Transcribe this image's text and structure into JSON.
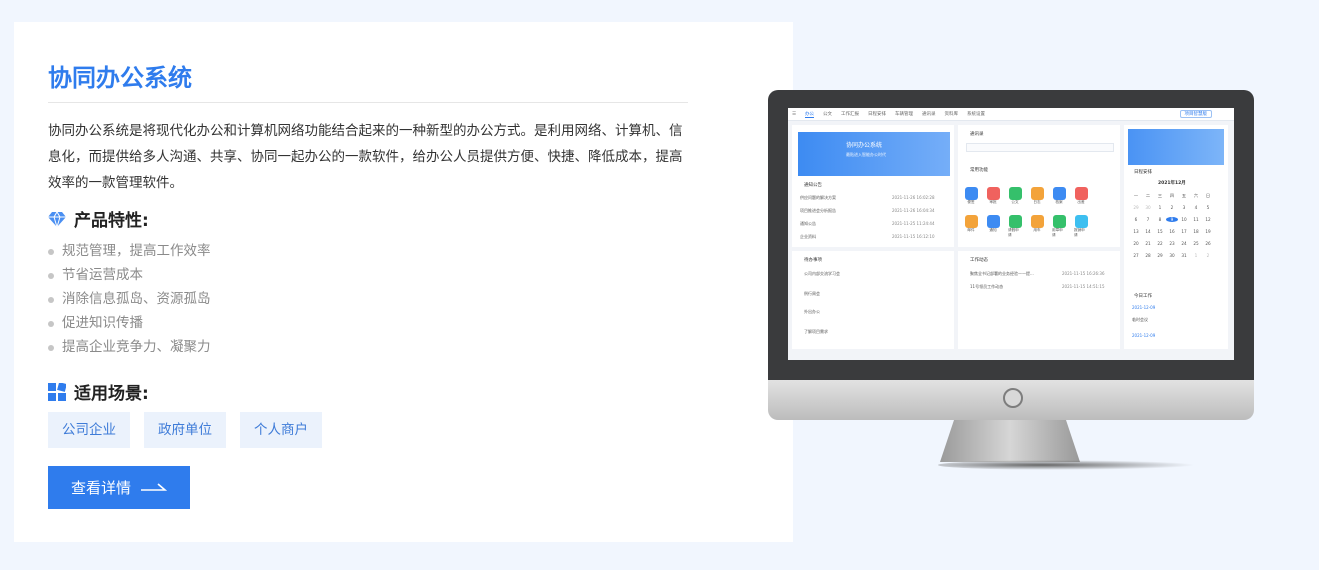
{
  "card": {
    "title": "协同办公系统",
    "description": "协同办公系统是将现代化办公和计算机网络功能结合起来的一种新型的办公方式。是利用网络、计算机、信息化，而提供给多人沟通、共享、协同一起办公的一款软件，给办公人员提供方便、快捷、降低成本，提高效率的一款管理软件。",
    "features_heading": "产品特性:",
    "features": [
      "规范管理，提高工作效率",
      "节省运营成本",
      "消除信息孤岛、资源孤岛",
      "促进知识传播",
      "提高企业竞争力、凝聚力"
    ],
    "scenes_heading": "适用场景:",
    "scenes": [
      "公司企业",
      "政府单位",
      "个人商户"
    ],
    "detail_button": "查看详情"
  },
  "screen": {
    "nav": [
      "办公",
      "公文",
      "工作汇报",
      "日程安排",
      "车辆管理",
      "通讯录",
      "资料库",
      "系统设置"
    ],
    "nav_right_button": "项目智慧版",
    "banner_title": "协同办公系统",
    "banner_sub": "最贴进入智能办公时代",
    "notice_heading": "通知公告",
    "notices": [
      {
        "t": "供应问题的解决方案",
        "d": "2021-11-26 16:02:28"
      },
      {
        "t": "项目推进会分析报告",
        "d": "2021-11-26 16:04:34"
      },
      {
        "t": "通知公告",
        "d": "2021-11-25 11:24:44"
      },
      {
        "t": "企业资料",
        "d": "2021-11-15 16:12:10"
      }
    ],
    "todo_heading": "待办事项",
    "todos": [
      "公司内部交流学习会",
      "例行周会",
      "外出办公",
      "了解项目需求"
    ],
    "contacts_heading": "通讯录",
    "functions_heading": "常用功能",
    "functions": [
      "便签",
      "审批",
      "公文",
      "日志",
      "档案",
      "出差",
      "邮件",
      "通知",
      "请假申请",
      "用车",
      "用章申请",
      "报销申请"
    ],
    "function_colors": [
      "#3d8bf2",
      "#f0625e",
      "#35c06b",
      "#f3a33a",
      "#3d8bf2",
      "#f0625e",
      "#f3a33a",
      "#3d8bf2",
      "#35c06b",
      "#f3a33a",
      "#35c06b",
      "#3dbff0"
    ],
    "work_heading": "工作动态",
    "works": [
      {
        "t": "聚焦全书记部署的业务经验——提...",
        "d": "2021-11-15 16:26:36"
      },
      {
        "t": "11号领员工作动态",
        "d": "2021-11-15 14:51:15"
      }
    ],
    "schedule_heading": "日程安排",
    "month": "2021年12月",
    "weekdays": [
      "一",
      "二",
      "三",
      "四",
      "五",
      "六",
      "日"
    ],
    "days": [
      "29",
      "30",
      "1",
      "2",
      "3",
      "4",
      "5",
      "6",
      "7",
      "8",
      "9",
      "10",
      "11",
      "12",
      "13",
      "14",
      "15",
      "16",
      "17",
      "18",
      "19",
      "20",
      "21",
      "22",
      "23",
      "24",
      "25",
      "26",
      "27",
      "28",
      "29",
      "30",
      "31",
      "1",
      "2"
    ],
    "today_heading": "今日工作",
    "today_items": [
      "2021-12-09",
      "临时会议",
      "2021-12-09"
    ]
  }
}
